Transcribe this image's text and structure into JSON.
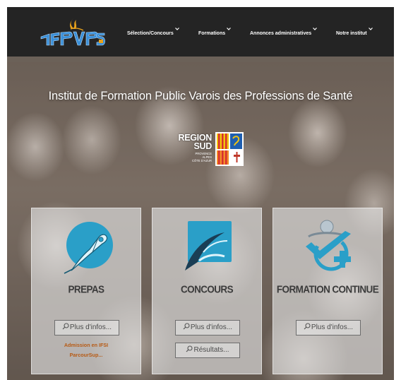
{
  "navbar": {
    "logo_text": "IFPVPS",
    "items": [
      {
        "label": "Sélection/Concours"
      },
      {
        "label": "Formations"
      },
      {
        "label": "Annonces administratives"
      },
      {
        "label": "Notre institut"
      }
    ]
  },
  "hero": {
    "headline": "Institut de Formation Public Varois des Professions de Santé",
    "region_logo": {
      "line1": "REGION",
      "line2": "SUD",
      "line3": "PROVENCE\nALPES\nCÔTE D'AZUR"
    }
  },
  "cards": [
    {
      "title": "PREPAS",
      "icon": "pen-nib-icon",
      "buttons": [
        {
          "label": "Plus d'infos..."
        }
      ],
      "links": [
        {
          "label": "Admission en IFSI"
        },
        {
          "label": "ParcourSup..."
        }
      ]
    },
    {
      "title": "CONCOURS",
      "icon": "concours-icon",
      "buttons": [
        {
          "label": "Plus d'infos..."
        },
        {
          "label": "Résultats..."
        }
      ],
      "links": []
    },
    {
      "title": "FORMATION CONTINUE",
      "icon": "person-check-plus-icon",
      "buttons": [
        {
          "label": "Plus d'infos..."
        }
      ],
      "links": []
    }
  ],
  "colors": {
    "navbar_bg": "#242424",
    "accent_blue": "#2a9fc8",
    "link_orange": "#b75a14",
    "card_title": "#3b3b3b"
  }
}
